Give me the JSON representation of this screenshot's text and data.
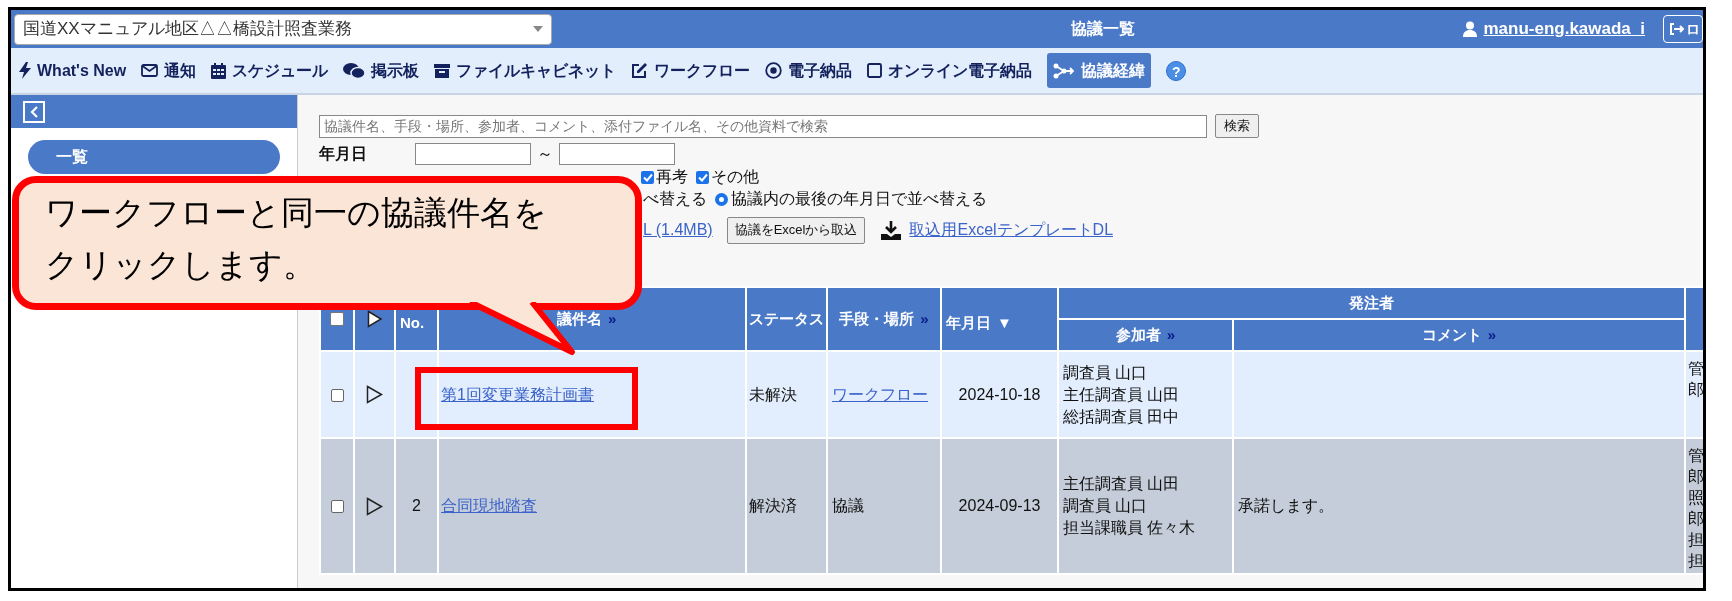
{
  "project_select": {
    "value": "国道XXマニュアル地区△△橋設計照査業務"
  },
  "header": {
    "title": "協議一覧",
    "user": "manu-eng.kawada_i",
    "logout": "ロ"
  },
  "nav": [
    {
      "label": "What's New",
      "selected": false
    },
    {
      "label": "通知",
      "selected": false
    },
    {
      "label": "スケジュール",
      "selected": false
    },
    {
      "label": "掲示板",
      "selected": false
    },
    {
      "label": "ファイルキャビネット",
      "selected": false
    },
    {
      "label": "ワークフロー",
      "selected": false
    },
    {
      "label": "電子納品",
      "selected": false
    },
    {
      "label": "オンライン電子納品",
      "selected": false
    },
    {
      "label": "協議経緯",
      "selected": true
    }
  ],
  "help": "?",
  "sidebar": {
    "items": [
      {
        "label": "一覧",
        "selected": true
      }
    ]
  },
  "search": {
    "placeholder": "協議件名、手段・場所、参加者、コメント、添付ファイル名、その他資料で検索",
    "button": "検索"
  },
  "date_filter": {
    "label": "年月日",
    "separator": "～"
  },
  "status_filters": [
    {
      "label": "再考",
      "checked": true
    },
    {
      "label": "その他",
      "checked": true
    }
  ],
  "sort_partial": "べ替える",
  "sort_options": [
    {
      "label": "協議内の最後の年月日で並べ替える",
      "selected": true
    }
  ],
  "actions": {
    "manual_link": "L (1.4MB)",
    "import_button": "協議をExcelから取込",
    "template_link": "取込用ExcelテンプレートDL"
  },
  "callout": {
    "lines": [
      "ワークフローと同一の協議件名を",
      "クリックします。"
    ]
  },
  "table": {
    "group_header": "発注者",
    "columns": [
      {
        "kind": "check",
        "checked": false
      },
      {
        "kind": "expand"
      },
      {
        "kind": "text",
        "label": "No."
      },
      {
        "kind": "text",
        "label": "議件名",
        "more": "»"
      },
      {
        "kind": "text",
        "label": "ステータス"
      },
      {
        "kind": "text",
        "label": "手段・場所",
        "more": "»"
      },
      {
        "kind": "text",
        "label": "年月日",
        "sort": "▼"
      },
      {
        "kind": "group",
        "label": "参加者",
        "more": "»"
      },
      {
        "kind": "group",
        "label": "コメント",
        "more": "»"
      },
      {
        "kind": "blank"
      }
    ],
    "rows": [
      {
        "highlighted": true,
        "checked": false,
        "title": "第1回変更業務計画書",
        "status": "未解決",
        "method": "ワークフロー",
        "method_link": true,
        "date": "2024-10-18",
        "participants": [
          "調査員 山口",
          "主任調査員 山田",
          "総括調査員 田中"
        ],
        "column_10": [
          "管",
          "郎"
        ]
      },
      {
        "highlighted": false,
        "checked": false,
        "no": "2",
        "title": "合同現地踏査",
        "status": "解決済",
        "method": "協議",
        "method_link": false,
        "date": "2024-09-13",
        "participants": [
          "主任調査員 山田",
          "調査員 山口",
          "担当課職員 佐々木"
        ],
        "comment": "承諾します。",
        "column_10": [
          "管",
          "郎",
          "照",
          "郎",
          "担",
          "担"
        ]
      }
    ]
  }
}
